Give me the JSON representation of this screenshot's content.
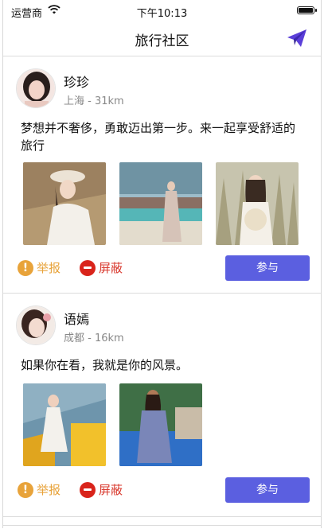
{
  "status": {
    "carrier": "运营商",
    "time": "下午10:13"
  },
  "nav": {
    "title": "旅行社区",
    "send_icon": "paper-plane-icon"
  },
  "posts": [
    {
      "name": "珍珍",
      "location": "上海 - 31km",
      "text": "梦想并不奢侈，勇敢迈出第一步。来一起享受舒适的旅行",
      "photo_count": 3,
      "report_label": "举报",
      "block_label": "屏蔽",
      "join_label": "参与"
    },
    {
      "name": "语嫣",
      "location": "成都 - 16km",
      "text": "如果你在看，我就是你的风景。",
      "photo_count": 2,
      "report_label": "举报",
      "block_label": "屏蔽",
      "join_label": "参与"
    }
  ],
  "colors": {
    "accent": "#5b5fe0",
    "report": "#e8a33a",
    "block": "#d93a2f"
  }
}
